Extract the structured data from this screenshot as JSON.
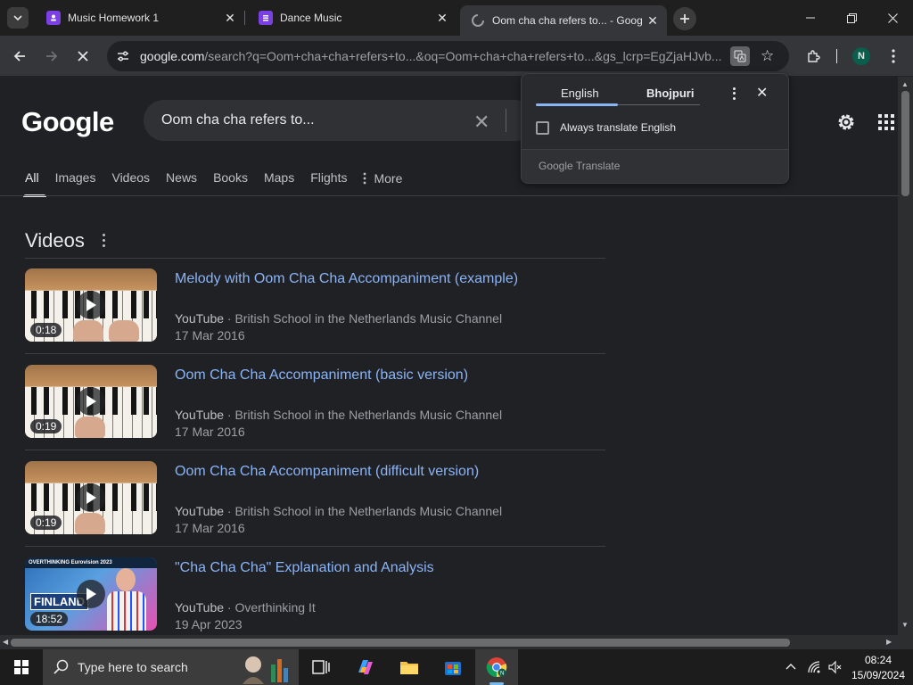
{
  "browser": {
    "tabs": [
      {
        "title": "Music Homework 1",
        "favicon_color": "#7b3fe4"
      },
      {
        "title": "Dance Music",
        "favicon_color": "#7b3fe4"
      },
      {
        "title": "Oom cha cha refers to... - Goog",
        "favicon_color": "#9aa0a6"
      }
    ],
    "url_host": "google.com",
    "url_path": "/search?q=Oom+cha+cha+refers+to...&oq=Oom+cha+cha+refers+to...&gs_lcrp=EgZjaHJvb...",
    "profile_initial": "N"
  },
  "google": {
    "logo": "Google",
    "query": "Oom cha cha refers to...",
    "nav_tabs": [
      "All",
      "Images",
      "Videos",
      "News",
      "Books",
      "Maps",
      "Flights"
    ],
    "nav_selected": "All",
    "nav_more": "More"
  },
  "translate": {
    "lang_from": "English",
    "lang_to": "Bhojpuri",
    "checkbox_label": "Always translate English",
    "checkbox_checked": false,
    "footer": "Google Translate"
  },
  "videos": {
    "heading": "Videos",
    "items": [
      {
        "title": "Melody with Oom Cha Cha Accompaniment (example)",
        "source": "YouTube",
        "channel": "British School in the Netherlands Music Channel",
        "date": "17 Mar 2016",
        "duration": "0:18"
      },
      {
        "title": "Oom Cha Cha Accompaniment (basic version)",
        "source": "YouTube",
        "channel": "British School in the Netherlands Music Channel",
        "date": "17 Mar 2016",
        "duration": "0:19"
      },
      {
        "title": "Oom Cha Cha Accompaniment (difficult version)",
        "source": "YouTube",
        "channel": "British School in the Netherlands Music Channel",
        "date": "17 Mar 2016",
        "duration": "0:19"
      },
      {
        "title": "\"Cha Cha Cha\" Explanation and Analysis",
        "source": "YouTube",
        "channel": "Overthinking It",
        "date": "19 Apr 2023",
        "duration": "18:52",
        "thumb_banner": "OVERTHINKING Eurovision 2023",
        "thumb_label": "FINLAND"
      }
    ]
  },
  "taskbar": {
    "search_placeholder": "Type here to search",
    "time": "08:24",
    "date": "15/09/2024"
  }
}
